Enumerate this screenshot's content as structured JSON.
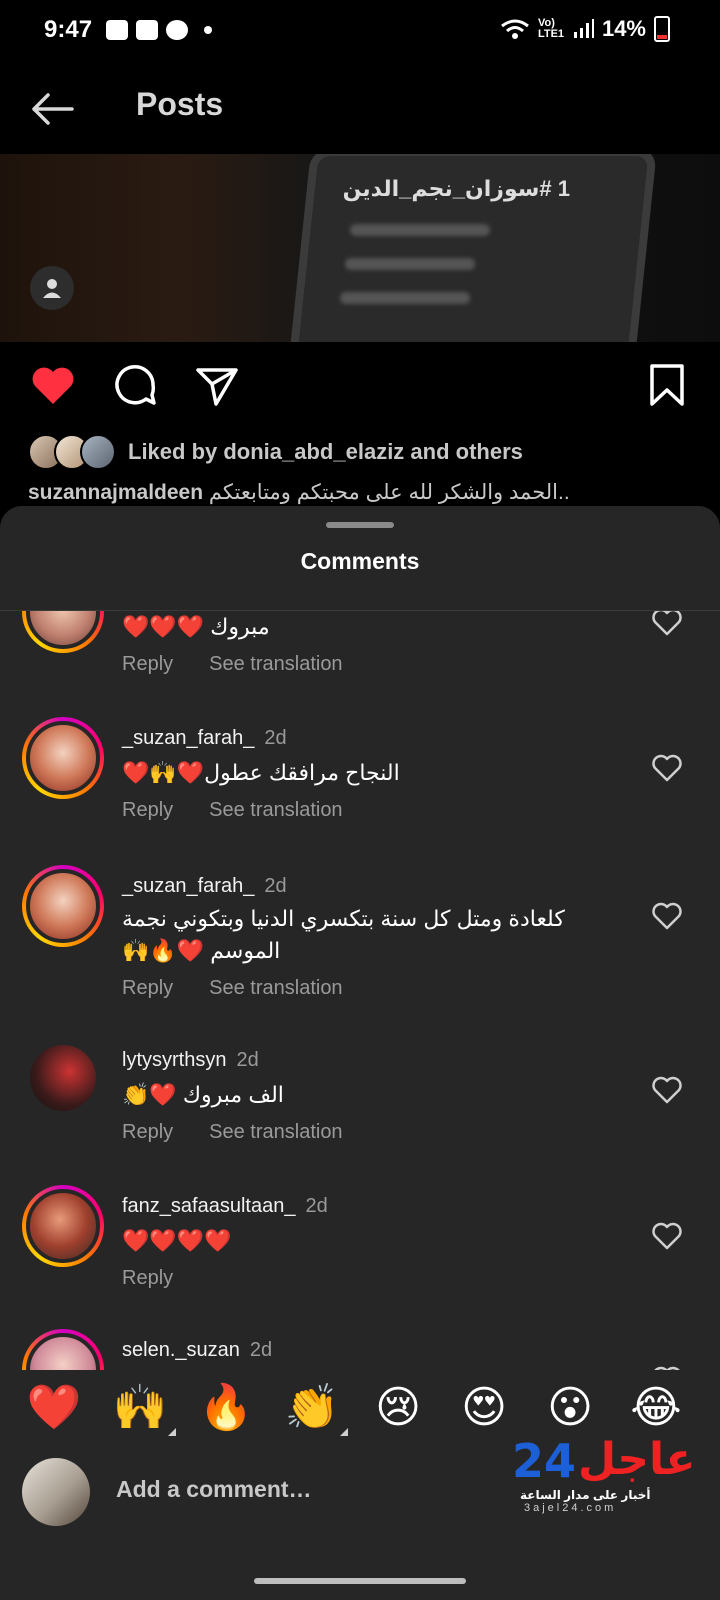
{
  "status_bar": {
    "time": "9:47",
    "network": "Vo) LTE1",
    "battery": "14%",
    "icons": [
      "gallery-icon",
      "youtube-icon",
      "soccer-icon",
      "dot-icon",
      "wifi-icon",
      "signal-icon",
      "battery-icon"
    ]
  },
  "header": {
    "title": "Posts",
    "back_icon": "arrow-left-icon"
  },
  "post": {
    "image_text": "1 #سوزان_نجم_الدين",
    "liked_by": "Liked by donia_abd_elaziz and others",
    "caption_user": "suzannajmaldeen",
    "caption_text": "الحمد والشكر لله على محبتكم ومتابعتكم.."
  },
  "comments_sheet": {
    "title": "Comments",
    "comments": [
      {
        "user": "",
        "time": "",
        "text": "مبروك ❤️❤️❤️",
        "reply": "Reply",
        "translate": "See translation"
      },
      {
        "user": "_suzan_farah_",
        "time": "2d",
        "text": "النجاح مرافقك عطول❤️🙌❤️",
        "reply": "Reply",
        "translate": "See translation"
      },
      {
        "user": "_suzan_farah_",
        "time": "2d",
        "text": "كلعادة ومتل كل سنة بتكسري الدنيا وبتكوني نجمة الموسم ❤️🔥🙌",
        "reply": "Reply",
        "translate": "See translation"
      },
      {
        "user": "lytysyrthsyn",
        "time": "2d",
        "text": "الف مبروك ❤️👏",
        "reply": "Reply",
        "translate": "See translation"
      },
      {
        "user": "fanz_safaasultaan_",
        "time": "2d",
        "text": "❤️❤️❤️❤️",
        "reply": "Reply",
        "translate": ""
      },
      {
        "user": "selen._suzan",
        "time": "2d",
        "text": "",
        "reply": "",
        "translate": ""
      }
    ]
  },
  "emoji_bar": [
    "❤️",
    "🙌",
    "🔥",
    "👏",
    "😢",
    "😍",
    "😮",
    "😂"
  ],
  "composer": {
    "placeholder": "Add a comment…"
  },
  "watermark": {
    "number": "24",
    "word": "عاجل",
    "tagline": "أخبار على مدار الساعة",
    "url": "3ajel24.com"
  },
  "colors": {
    "background": "#000000",
    "sheet": "#262626",
    "like_red": "#ff3040",
    "muted_text": "#9a9a9a"
  }
}
